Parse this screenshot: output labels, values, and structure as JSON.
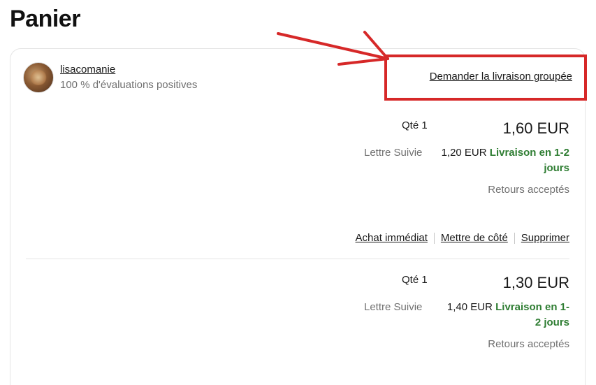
{
  "page": {
    "title": "Panier"
  },
  "seller": {
    "name": "lisacomanie",
    "rating": "100 % d'évaluations positives",
    "combine_shipping_link": "Demander la livraison groupée"
  },
  "items": [
    {
      "qty": "Qté 1",
      "price": "1,60 EUR",
      "shipping_method": "Lettre Suivie",
      "shipping_cost": "1,20 EUR",
      "delivery": "Livraison en 1-2 jours",
      "returns": "Retours acceptés",
      "actions": {
        "buy_now": "Achat immédiat",
        "save_for_later": "Mettre de côté",
        "remove": "Supprimer"
      }
    },
    {
      "qty": "Qté 1",
      "price": "1,30 EUR",
      "shipping_method": "Lettre Suivie",
      "shipping_cost": "1,40 EUR",
      "delivery": "Livraison en 1-2 jours",
      "returns": "Retours acceptés"
    }
  ],
  "annotation": {
    "color": "#d62828"
  },
  "colors": {
    "delivery_green": "#2e7d32",
    "muted_text": "#707070"
  }
}
